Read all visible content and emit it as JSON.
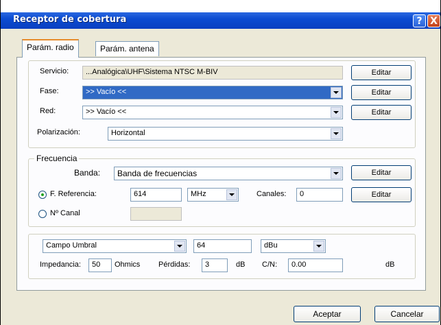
{
  "window": {
    "title": "Receptor de cobertura",
    "help": "?",
    "close": "X"
  },
  "tabs": [
    {
      "label": "Parám. radio"
    },
    {
      "label": "Parám. antena"
    }
  ],
  "servicio": {
    "label": "Servicio:",
    "value": "...Analógica\\UHF\\Sistema NTSC M-BIV",
    "button": "Editar"
  },
  "fase": {
    "label": "Fase:",
    "value": ">> Vacío <<",
    "button": "Editar"
  },
  "red": {
    "label": "Red:",
    "value": ">> Vacío <<",
    "button": "Editar"
  },
  "polarizacion": {
    "label": "Polarización:",
    "value": "Horizontal"
  },
  "frecuencia": {
    "group_label": "Frecuencia",
    "banda_label": "Banda:",
    "banda_value": "Banda de frecuencias",
    "banda_button": "Editar",
    "freq_ref_label": "F. Referencia:",
    "freq_ref_value": "614",
    "freq_unit": "MHz",
    "canales_label": "Canales:",
    "canales_value": "0",
    "canales_button": "Editar",
    "canal_label": "Nº Canal",
    "canal_value": ""
  },
  "umbral": {
    "type_value": "Campo Umbral",
    "value": "64",
    "unit": "dBu",
    "impedancia_label": "Impedancia:",
    "impedancia_value": "50",
    "impedancia_unit": "Ohmics",
    "perdidas_label": "Pérdidas:",
    "perdidas_value": "3",
    "perdidas_unit": "dB",
    "cn_label": "C/N:",
    "cn_value": "0.00",
    "cn_unit": "dB"
  },
  "footer": {
    "accept": "Aceptar",
    "cancel": "Cancelar"
  }
}
